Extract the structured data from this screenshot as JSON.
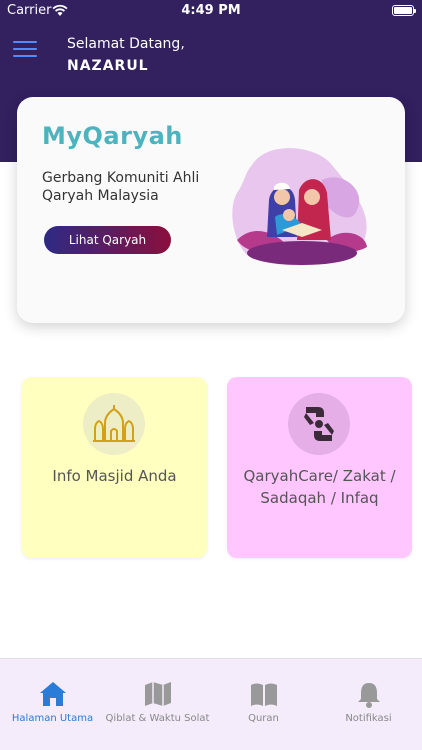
{
  "status_bar": {
    "carrier": "Carrier",
    "time": "4:49 PM"
  },
  "header": {
    "greeting": "Selamat Datang,",
    "user_name": "NAZARUL"
  },
  "hero": {
    "title": "MyQaryah",
    "subtitle": "Gerbang Komuniti Ahli Qaryah Malaysia",
    "button_label": "Lihat Qaryah"
  },
  "tiles": [
    {
      "label": "Info Masjid Anda",
      "icon": "mosque-icon"
    },
    {
      "label": "QaryahCare/ Zakat / Sadaqah / Infaq",
      "icon": "charity-hands-icon"
    }
  ],
  "tabbar": {
    "tabs": [
      {
        "label": "Halaman Utama",
        "icon": "home-icon",
        "active": true
      },
      {
        "label": "Qiblat & Waktu Solat",
        "icon": "map-icon",
        "active": false
      },
      {
        "label": "Quran",
        "icon": "book-icon",
        "active": false
      },
      {
        "label": "Notifikasi",
        "icon": "bell-icon",
        "active": false
      }
    ]
  },
  "colors": {
    "header_bg": "#32205f",
    "brand_teal": "#4db3bf",
    "tile_masjid_bg": "#ffffc0",
    "tile_care_bg": "#ffc6ff",
    "tab_active": "#2a7cd9"
  }
}
